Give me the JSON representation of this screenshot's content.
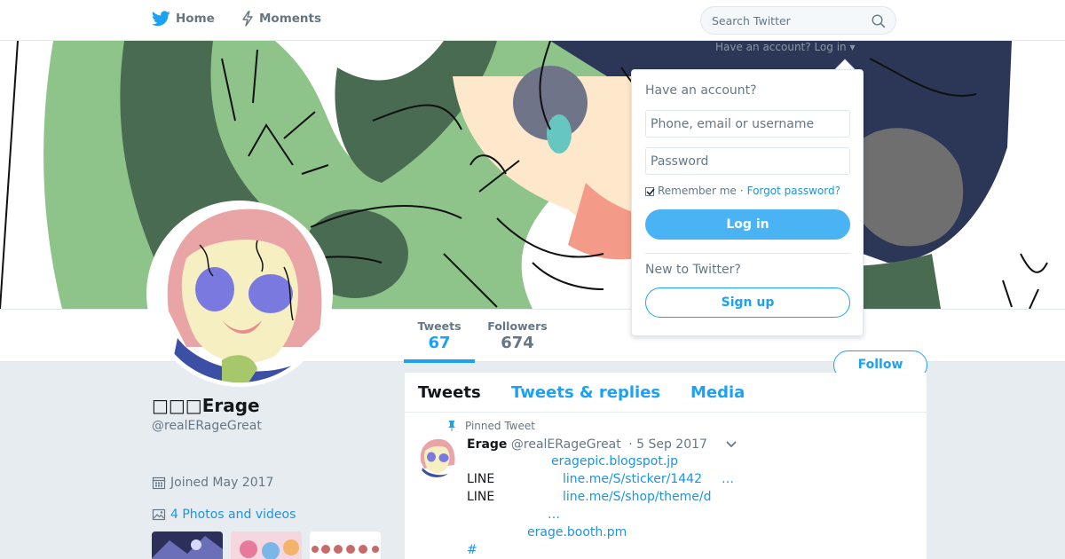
{
  "topbar": {
    "home_label": "Home",
    "moments_label": "Moments",
    "search_placeholder": "Search Twitter"
  },
  "behind_text": "Have an account? Log in ▾",
  "profile": {
    "name": "□□□Erage",
    "handle": "@realERageGreat",
    "joined": "Joined May 2017",
    "photos_label": "4 Photos and videos"
  },
  "stats": [
    {
      "label": "Tweets",
      "value": "67"
    },
    {
      "label": "Followers",
      "value": "674"
    }
  ],
  "follow_label": "Follow",
  "timeline": {
    "tabs": [
      "Tweets",
      "Tweets & replies",
      "Media"
    ],
    "pinned_label": "Pinned Tweet",
    "tweet": {
      "name": "Erage",
      "handle": "@realERageGreat",
      "date": "· 5 Sep 2017",
      "lines": [
        {
          "prefix": "",
          "link": "eragepic.blogspot.jp",
          "suffix": ""
        },
        {
          "prefix": "LINE",
          "link": "line.me/S/sticker/1442",
          "suffix": "…"
        },
        {
          "prefix": "LINE",
          "link": "line.me/S/shop/theme/d",
          "suffix": ""
        },
        {
          "prefix": "",
          "link": "…",
          "suffix": ""
        },
        {
          "prefix": "",
          "link": "erage.booth.pm",
          "suffix": ""
        },
        {
          "prefix": "",
          "link": "#",
          "suffix": ""
        }
      ]
    }
  },
  "login": {
    "heading": "Have an account?",
    "username_placeholder": "Phone, email or username",
    "password_placeholder": "Password",
    "remember": "Remember me",
    "separator": "·",
    "forgot": "Forgot password?",
    "login_button": "Log in",
    "new_heading": "New to Twitter?",
    "signup_button": "Sign up"
  },
  "colors": {
    "accent": "#1da1f2",
    "background": "#e6ecf0",
    "login_button": "#4ab3f4"
  }
}
